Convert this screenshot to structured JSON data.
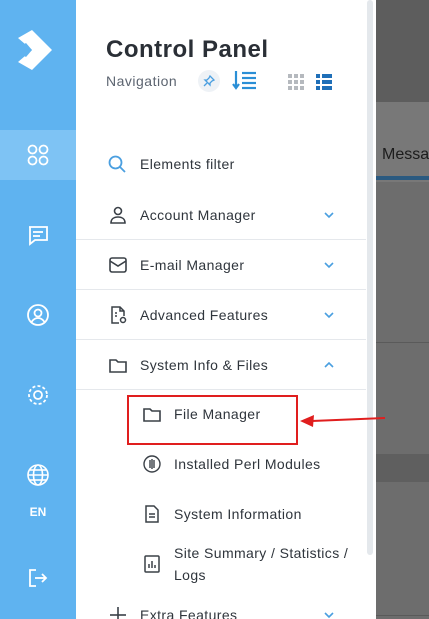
{
  "panel": {
    "title": "Control Panel",
    "subtitle": "Navigation"
  },
  "filter": {
    "label": "Elements filter"
  },
  "menu": [
    {
      "label": "Account Manager",
      "icon": "user-icon",
      "expanded": false
    },
    {
      "label": "E-mail Manager",
      "icon": "mail-icon",
      "expanded": false
    },
    {
      "label": "Advanced Features",
      "icon": "advanced-file-icon",
      "expanded": false
    },
    {
      "label": "System Info & Files",
      "icon": "folder-icon",
      "expanded": true
    }
  ],
  "submenu": [
    {
      "label": "File Manager",
      "icon": "folder-icon"
    },
    {
      "label": "Installed Perl Modules",
      "icon": "perl-icon"
    },
    {
      "label": "System Information",
      "icon": "document-icon"
    },
    {
      "label": "Site Summary / Statistics / Logs",
      "icon": "stats-icon"
    }
  ],
  "extra": {
    "label": "Extra Features",
    "icon": "plus-icon"
  },
  "rail": {
    "language": "EN",
    "items": [
      "dashboard-icon",
      "chat-icon",
      "user-circle-icon",
      "settings-icon",
      "globe-icon",
      "logout-icon"
    ]
  },
  "background": {
    "tab_label": "Messa"
  },
  "colors": {
    "rail": "#5fb3f0",
    "rail_active": "#7ec3f4",
    "accent": "#2b8fd6",
    "highlight": "#e01e1e"
  }
}
